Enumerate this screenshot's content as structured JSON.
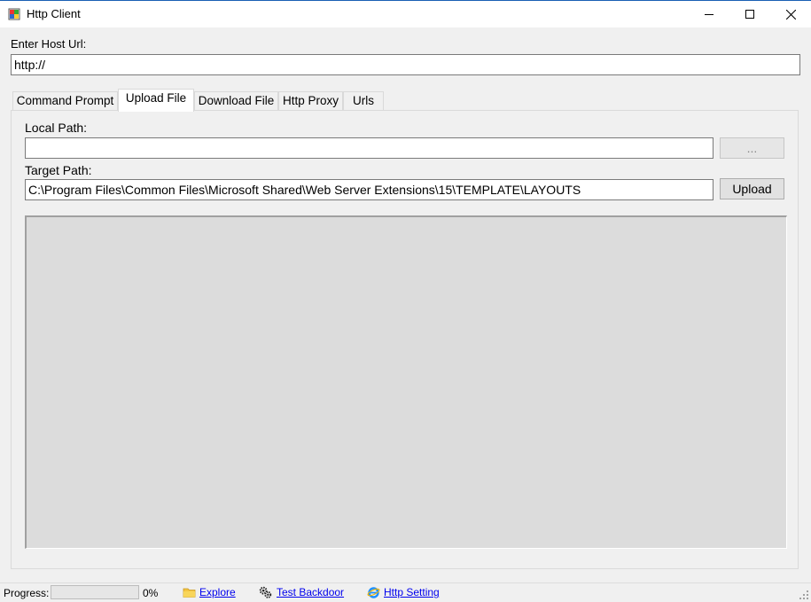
{
  "window": {
    "title": "Http Client",
    "controls": [
      "minimize",
      "maximize",
      "close"
    ]
  },
  "host": {
    "label": "Enter Host Url:",
    "value": "http://"
  },
  "tabs": [
    {
      "label": "Command Prompt",
      "active": false
    },
    {
      "label": "Upload File",
      "active": true
    },
    {
      "label": "Download File",
      "active": false
    },
    {
      "label": "Http Proxy",
      "active": false
    },
    {
      "label": "Urls",
      "active": false
    }
  ],
  "upload": {
    "local_path_label": "Local Path:",
    "local_path_value": "",
    "browse_label": "...",
    "target_path_label": "Target Path:",
    "target_path_value": "C:\\Program Files\\Common Files\\Microsoft Shared\\Web Server Extensions\\15\\TEMPLATE\\LAYOUTS",
    "upload_label": "Upload"
  },
  "status": {
    "progress_label": "Progress:",
    "progress_value": 0,
    "progress_text": "0%",
    "explore_label": "Explore",
    "explore_icon": "folder-icon",
    "backdoor_label": "Test Backdoor",
    "backdoor_icon": "gears-icon",
    "setting_label": "Http Setting",
    "setting_icon": "ie-icon"
  },
  "colors": {
    "link": "#0000ee",
    "title_border": "#1a5fb4",
    "output_bg": "#dcdcdc"
  }
}
